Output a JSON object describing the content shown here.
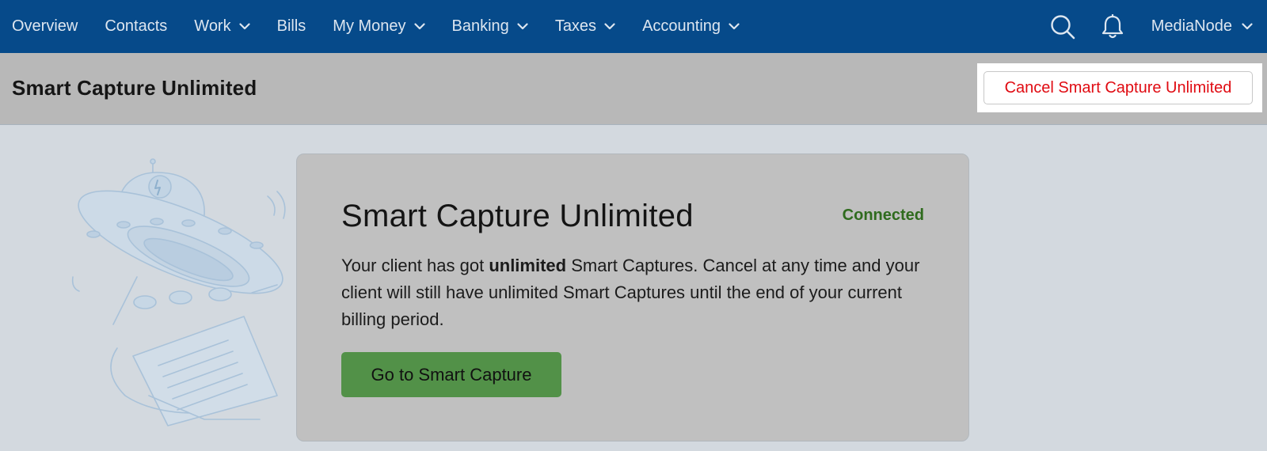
{
  "nav": {
    "items": [
      {
        "label": "Overview",
        "dropdown": false
      },
      {
        "label": "Contacts",
        "dropdown": false
      },
      {
        "label": "Work",
        "dropdown": true
      },
      {
        "label": "Bills",
        "dropdown": false
      },
      {
        "label": "My Money",
        "dropdown": true
      },
      {
        "label": "Banking",
        "dropdown": true
      },
      {
        "label": "Taxes",
        "dropdown": true
      },
      {
        "label": "Accounting",
        "dropdown": true
      }
    ],
    "account_label": "MediaNode",
    "icons": [
      "search-icon",
      "bell-icon"
    ],
    "colors": {
      "bar": "#064a8a",
      "text": "#dde6f0"
    }
  },
  "header": {
    "title": "Smart Capture Unlimited",
    "cancel_label": "Cancel Smart Capture Unlimited"
  },
  "card": {
    "title": "Smart Capture Unlimited",
    "status": "Connected",
    "desc_before": "Your client has got ",
    "desc_bold": "unlimited",
    "desc_after": " Smart Captures. Cancel at any time and your client will still have unlimited Smart Captures until the end of your current billing period.",
    "button_label": "Go to Smart Capture"
  },
  "colors": {
    "cancel_text": "#e00b12",
    "status_text": "#2f6b1e",
    "button_bg": "#529148"
  }
}
